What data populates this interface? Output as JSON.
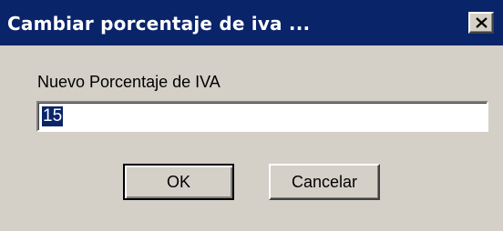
{
  "dialog": {
    "title": "Cambiar porcentaje de iva ...",
    "close_icon": "close-icon",
    "field_label": "Nuevo Porcentaje de IVA",
    "field_value": "15",
    "ok_label": "OK",
    "cancel_label": "Cancelar"
  },
  "colors": {
    "titlebar": "#0a246a",
    "face": "#d4d0c8",
    "selection": "#0a246a"
  }
}
